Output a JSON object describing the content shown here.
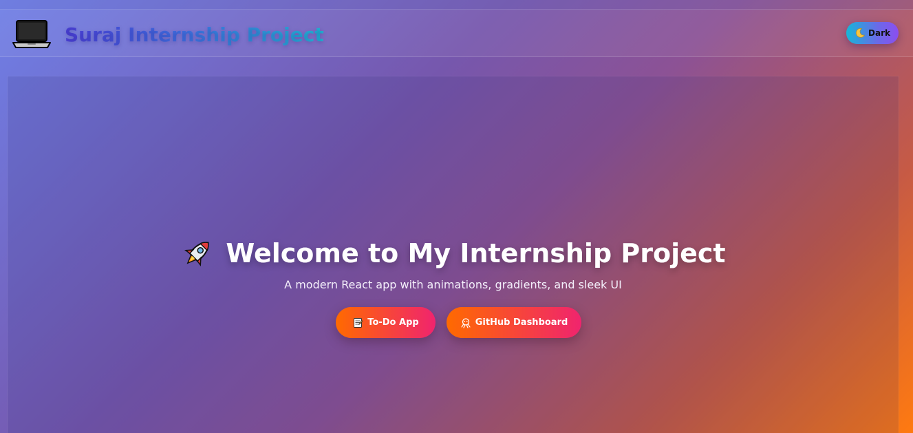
{
  "header": {
    "title": "Suraj Internship Project",
    "logo_icon": "laptop-icon",
    "theme_toggle": {
      "label": "Dark",
      "icon": "moon-icon"
    }
  },
  "hero": {
    "icon": "rocket-icon",
    "title": "Welcome to My Internship Project",
    "subtitle": "A modern React app with animations, gradients, and sleek UI",
    "buttons": [
      {
        "label": "To-Do App",
        "icon": "memo-icon"
      },
      {
        "label": "GitHub Dashboard",
        "icon": "octopus-icon"
      }
    ]
  },
  "colors": {
    "background_start": "#6f7fe6",
    "background_mid": "#7657ad",
    "background_end": "#ff7a10",
    "button_gradient_start": "#ff6a00",
    "button_gradient_end": "#f0246e",
    "toggle_gradient_start": "#16b6d8",
    "toggle_gradient_end": "#8b4ef0",
    "brand_gradient_start": "#4a3fd6",
    "brand_gradient_end": "#1fb7d4"
  }
}
